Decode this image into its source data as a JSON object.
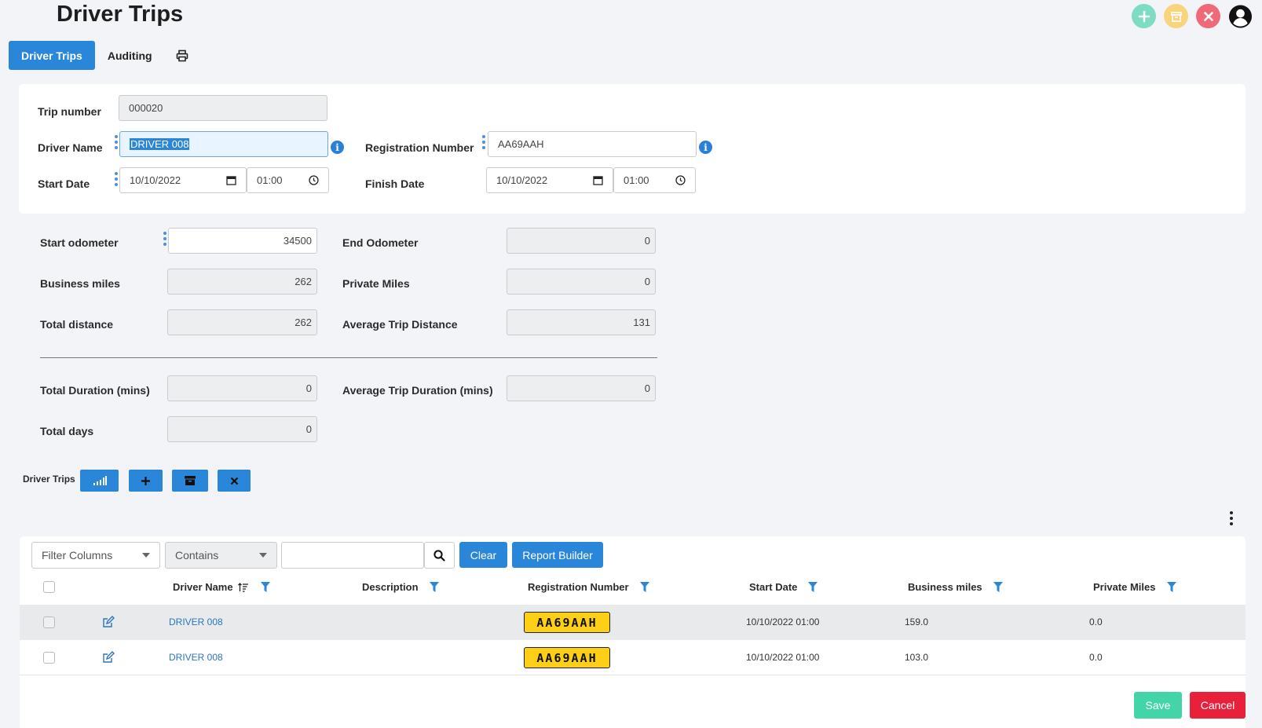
{
  "page": {
    "title": "Driver Trips"
  },
  "tabs": [
    {
      "label": "Driver Trips",
      "active": true
    },
    {
      "label": "Auditing",
      "active": false
    }
  ],
  "form": {
    "trip_number": {
      "label": "Trip number",
      "value": "000020"
    },
    "driver_name": {
      "label": "Driver Name",
      "value": "DRIVER 008"
    },
    "registration_number": {
      "label": "Registration Number",
      "value": "AA69AAH"
    },
    "start_date": {
      "label": "Start Date",
      "date": "10/10/2022",
      "time": "01:00"
    },
    "finish_date": {
      "label": "Finish Date",
      "date": "10/10/2022",
      "time": "01:00"
    }
  },
  "stats": {
    "start_odometer": {
      "label": "Start odometer",
      "value": "34500"
    },
    "end_odometer": {
      "label": "End Odometer",
      "value": "0"
    },
    "business_miles": {
      "label": "Business miles",
      "value": "262"
    },
    "private_miles": {
      "label": "Private Miles",
      "value": "0"
    },
    "total_distance": {
      "label": "Total distance",
      "value": "262"
    },
    "average_trip_distance": {
      "label": "Average Trip Distance",
      "value": "131"
    },
    "total_duration": {
      "label": "Total Duration (mins)",
      "value": "0"
    },
    "average_trip_duration": {
      "label": "Average Trip Duration (mins)",
      "value": "0"
    },
    "total_days": {
      "label": "Total days",
      "value": "0"
    }
  },
  "grid": {
    "toolbar_label": "Driver Trips",
    "filter_columns": "Filter Columns",
    "filter_operator": "Contains",
    "search_value": "",
    "clear_label": "Clear",
    "report_builder_label": "Report Builder",
    "columns": [
      "Driver Name",
      "Description",
      "Registration Number",
      "Start Date",
      "Business miles",
      "Private Miles"
    ],
    "rows": [
      {
        "driver": "DRIVER 008",
        "description": "",
        "registration": "AA69AAH",
        "start_date": "10/10/2022 01:00",
        "business_miles": "159.0",
        "private_miles": "0.0"
      },
      {
        "driver": "DRIVER 008",
        "description": "",
        "registration": "AA69AAH",
        "start_date": "10/10/2022 01:00",
        "business_miles": "103.0",
        "private_miles": "0.0"
      }
    ]
  },
  "actions": {
    "save_label": "Save",
    "cancel_label": "Cancel"
  },
  "colors": {
    "primary": "#2a86d9",
    "save": "#43d4a7",
    "cancel": "#e8203a",
    "plate": "#fdd017"
  },
  "icons": [
    "add-circle-icon",
    "archive-circle-icon",
    "close-circle-icon",
    "user-account-icon",
    "printer-icon",
    "info-icon",
    "calendar-icon",
    "clock-icon",
    "chart-bars-icon",
    "plus-icon",
    "archive-icon",
    "close-icon",
    "search-icon",
    "filter-icon",
    "sort-icon",
    "edit-icon",
    "kebab-menu-icon"
  ]
}
